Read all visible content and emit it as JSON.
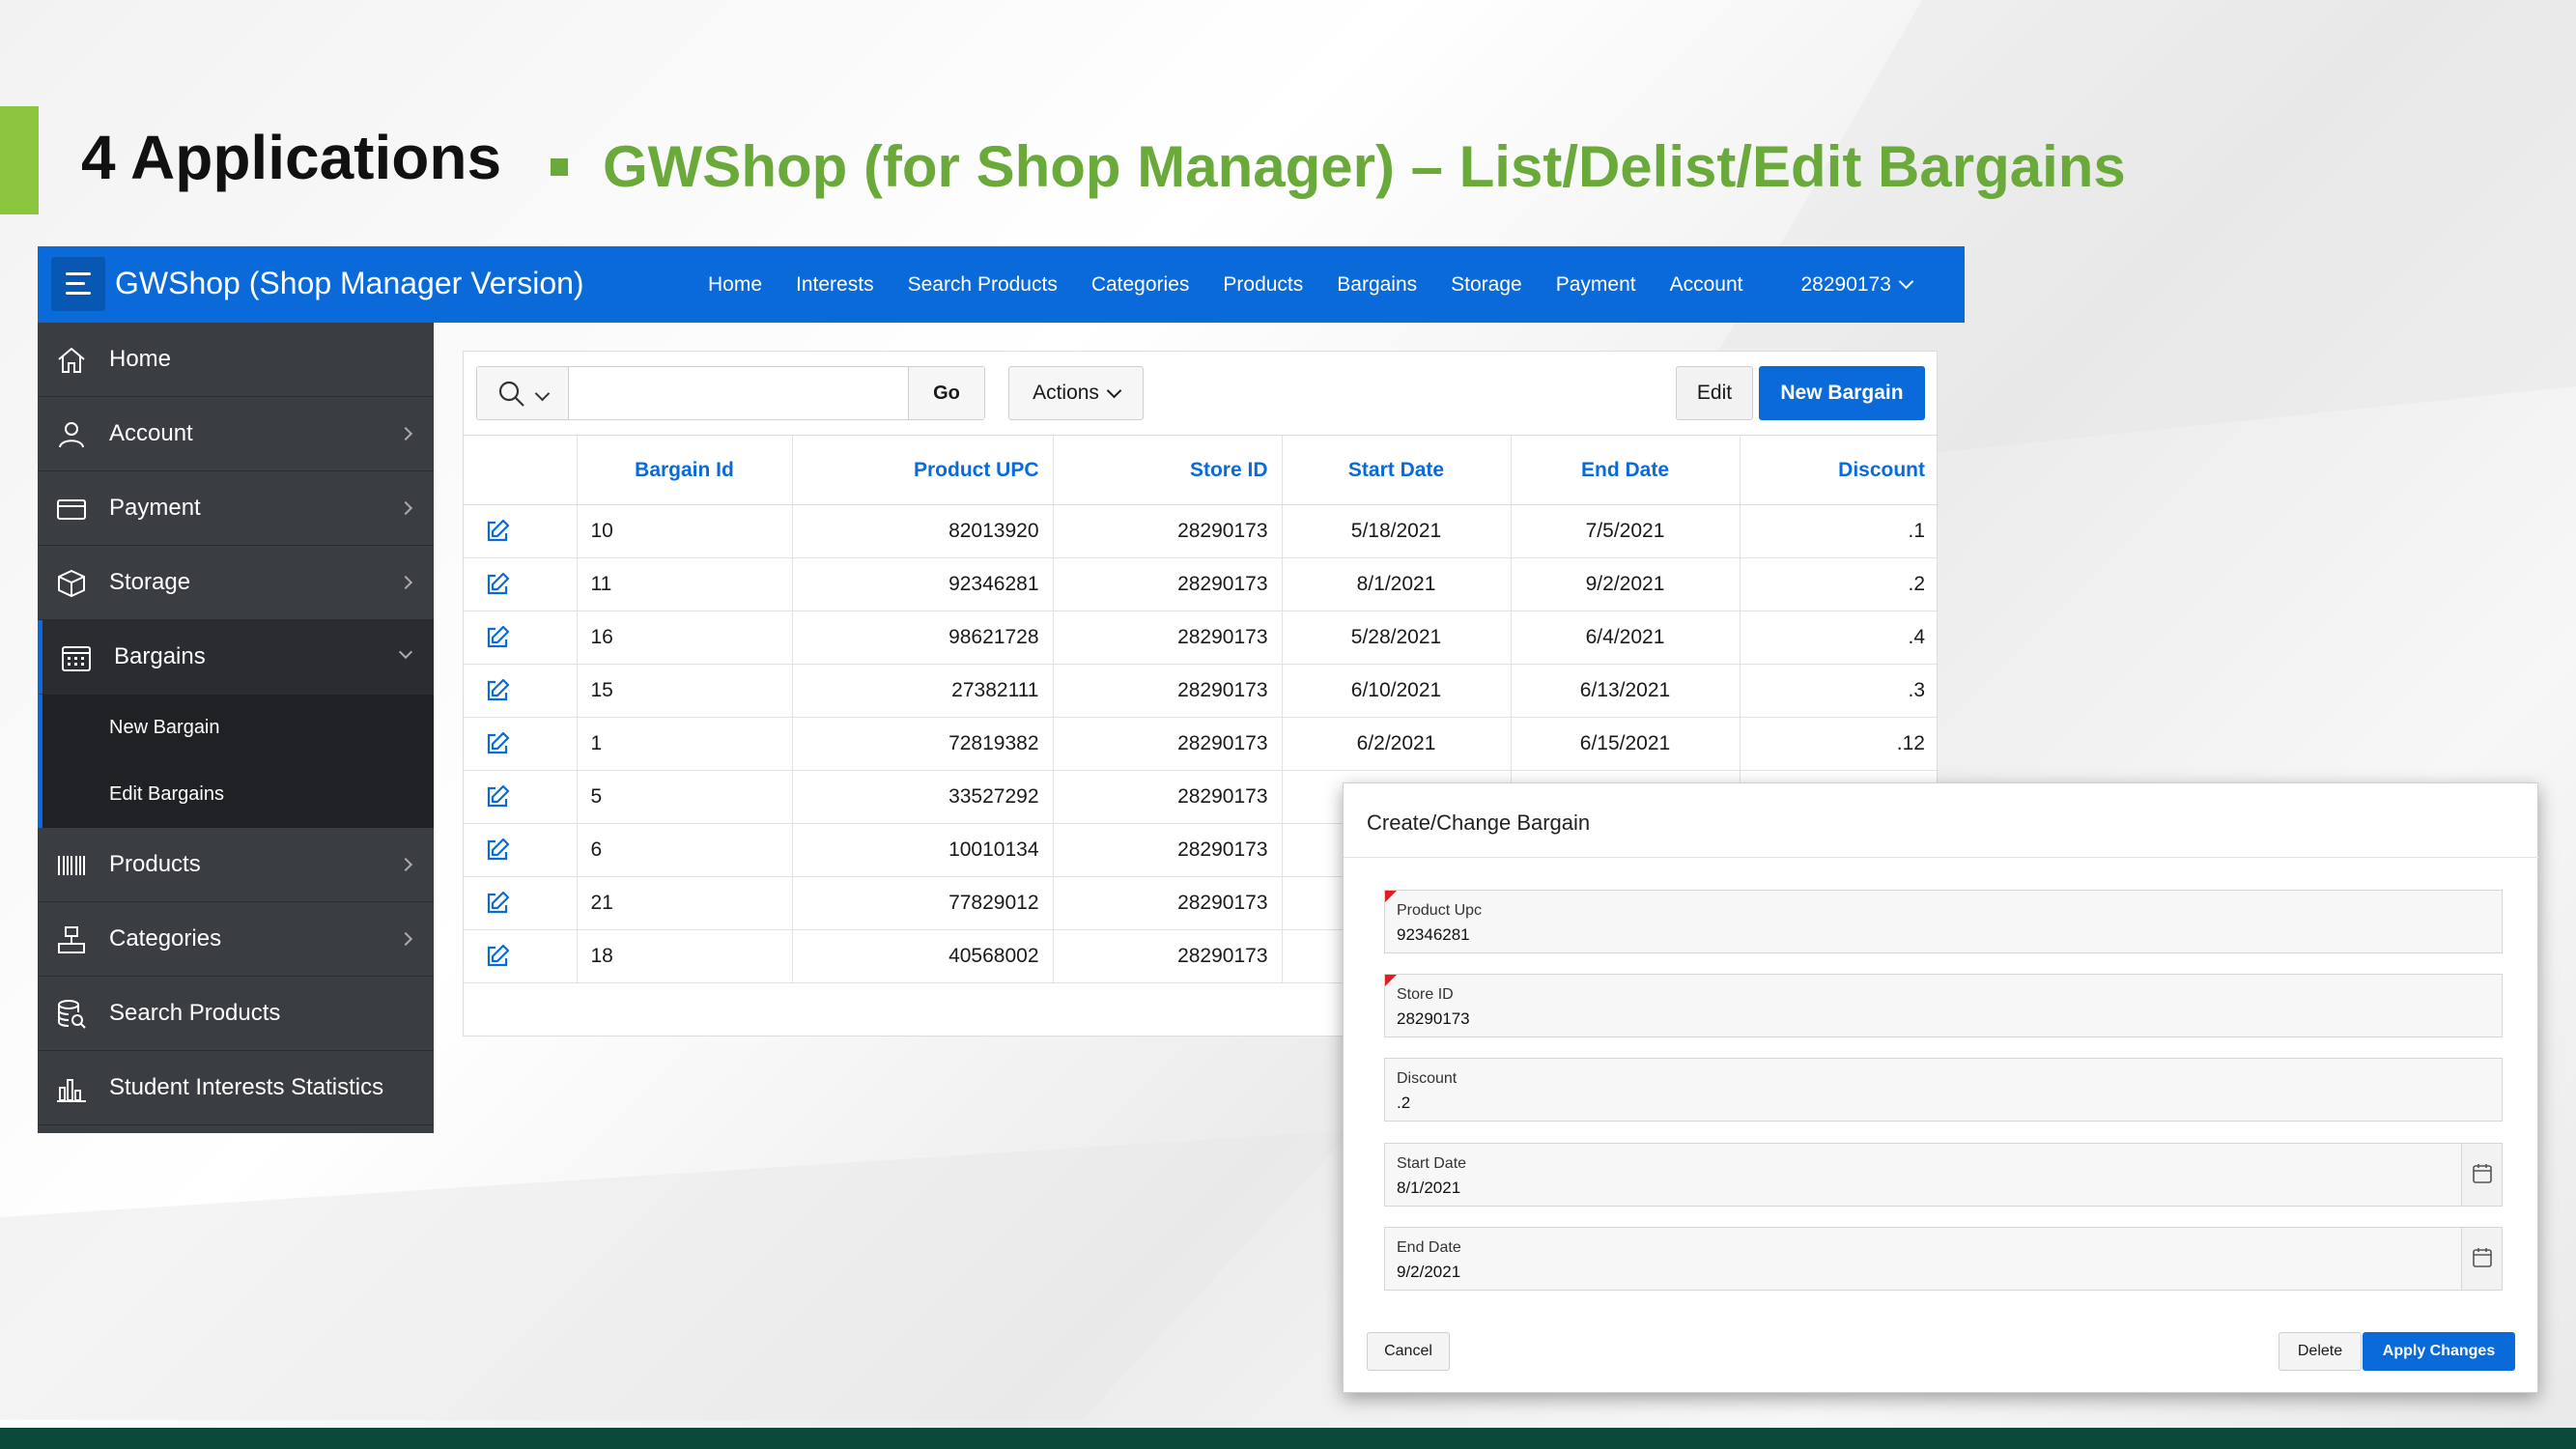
{
  "slide": {
    "title": "4 Applications",
    "subtitle": "GWShop (for Shop Manager) – List/Delist/Edit Bargains",
    "accent_color": "#8cc63f",
    "subtitle_color": "#6aaa3a"
  },
  "app": {
    "title": "GWShop (Shop Manager Version)",
    "brand_color": "#0a6ad9",
    "top_nav": [
      "Home",
      "Interests",
      "Search Products",
      "Categories",
      "Products",
      "Bargains",
      "Storage",
      "Payment",
      "Account"
    ],
    "user": "28290173"
  },
  "sidebar": {
    "items": [
      {
        "label": "Home",
        "icon": "home-icon",
        "arrow": false
      },
      {
        "label": "Account",
        "icon": "user-icon",
        "arrow": true
      },
      {
        "label": "Payment",
        "icon": "credit-card-icon",
        "arrow": true
      },
      {
        "label": "Storage",
        "icon": "box-icon",
        "arrow": true
      },
      {
        "label": "Bargains",
        "icon": "calendar-icon",
        "arrow": true,
        "expanded": true
      },
      {
        "label": "Products",
        "icon": "barcode-icon",
        "arrow": true
      },
      {
        "label": "Categories",
        "icon": "hierarchy-icon",
        "arrow": true
      },
      {
        "label": "Search Products",
        "icon": "database-search-icon",
        "arrow": false
      },
      {
        "label": "Student Interests Statistics",
        "icon": "bar-chart-icon",
        "arrow": false
      }
    ],
    "sub_items": [
      "New Bargain",
      "Edit Bargains"
    ]
  },
  "toolbar": {
    "search_placeholder": "",
    "go_label": "Go",
    "actions_label": "Actions",
    "edit_label": "Edit",
    "new_label": "New Bargain"
  },
  "table": {
    "columns": [
      "Bargain Id",
      "Product UPC",
      "Store ID",
      "Start Date",
      "End Date",
      "Discount"
    ],
    "rows": [
      [
        "10",
        "82013920",
        "28290173",
        "5/18/2021",
        "7/5/2021",
        ".1"
      ],
      [
        "11",
        "92346281",
        "28290173",
        "8/1/2021",
        "9/2/2021",
        ".2"
      ],
      [
        "16",
        "98621728",
        "28290173",
        "5/28/2021",
        "6/4/2021",
        ".4"
      ],
      [
        "15",
        "27382111",
        "28290173",
        "6/10/2021",
        "6/13/2021",
        ".3"
      ],
      [
        "1",
        "72819382",
        "28290173",
        "6/2/2021",
        "6/15/2021",
        ".12"
      ],
      [
        "5",
        "33527292",
        "28290173",
        "",
        "",
        ""
      ],
      [
        "6",
        "10010134",
        "28290173",
        "",
        "",
        ""
      ],
      [
        "21",
        "77829012",
        "28290173",
        "",
        "",
        ""
      ],
      [
        "18",
        "40568002",
        "28290173",
        "",
        "",
        ""
      ]
    ]
  },
  "dialog": {
    "title": "Create/Change Bargain",
    "fields": [
      {
        "label": "Product Upc",
        "value": "92346281",
        "required": true,
        "calendar": false
      },
      {
        "label": "Store ID",
        "value": "28290173",
        "required": true,
        "calendar": false
      },
      {
        "label": "Discount",
        "value": ".2",
        "required": false,
        "calendar": false
      },
      {
        "label": "Start Date",
        "value": "8/1/2021",
        "required": false,
        "calendar": true
      },
      {
        "label": "End Date",
        "value": "9/2/2021",
        "required": false,
        "calendar": true
      }
    ],
    "cancel_label": "Cancel",
    "delete_label": "Delete",
    "apply_label": "Apply Changes"
  }
}
